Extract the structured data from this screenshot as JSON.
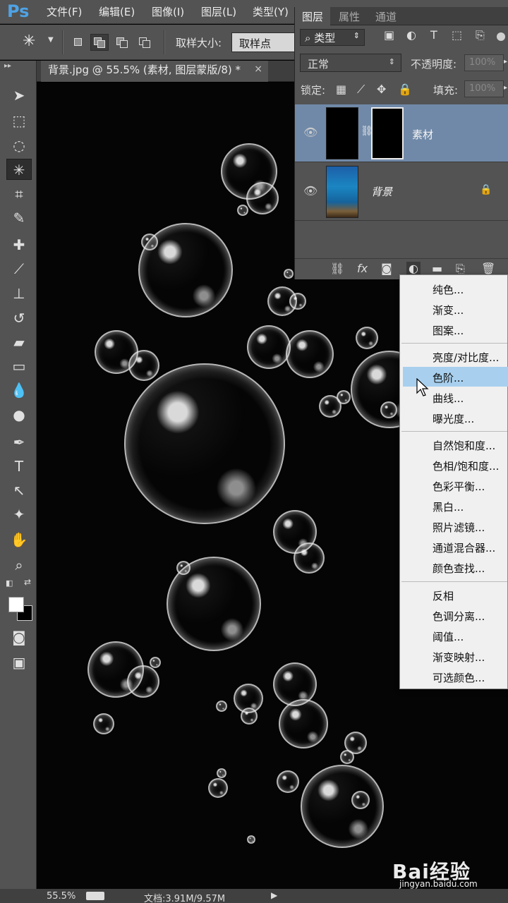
{
  "app": {
    "logo": "Ps"
  },
  "menubar": {
    "items": [
      "文件(F)",
      "编辑(E)",
      "图像(I)",
      "图层(L)",
      "类型(Y)"
    ]
  },
  "options": {
    "sample_size_label": "取样大小:",
    "sample_size_value": "取样点"
  },
  "document": {
    "tab_title": "背景.jpg @ 55.5% (素材, 图层蒙版/8) *",
    "close_glyph": "×"
  },
  "status": {
    "zoom": "55.5%",
    "doc_info": "文档:3.91M/9.57M",
    "arrow": "▶"
  },
  "layers_panel": {
    "tabs": [
      "图层",
      "属性",
      "通道"
    ],
    "filter_label": "类型",
    "blend_mode": "正常",
    "opacity_label": "不透明度:",
    "opacity_value": "100%",
    "lock_label": "锁定:",
    "fill_label": "填充:",
    "fill_value": "100%",
    "layers": [
      {
        "name": "素材",
        "selected": true
      },
      {
        "name": "背景",
        "locked": true
      }
    ]
  },
  "adjustment_menu": {
    "groups": [
      [
        "纯色...",
        "渐变...",
        "图案..."
      ],
      [
        "亮度/对比度...",
        "色阶...",
        "曲线...",
        "曝光度..."
      ],
      [
        "自然饱和度...",
        "色相/饱和度...",
        "色彩平衡...",
        "黑白...",
        "照片滤镜...",
        "通道混合器...",
        "颜色查找..."
      ],
      [
        "反相",
        "色调分离...",
        "阈值...",
        "渐变映射...",
        "可选颜色..."
      ]
    ],
    "highlighted": "色阶..."
  },
  "watermark": {
    "logo": "Bai经验",
    "url": "jingyan.baidu.com"
  }
}
